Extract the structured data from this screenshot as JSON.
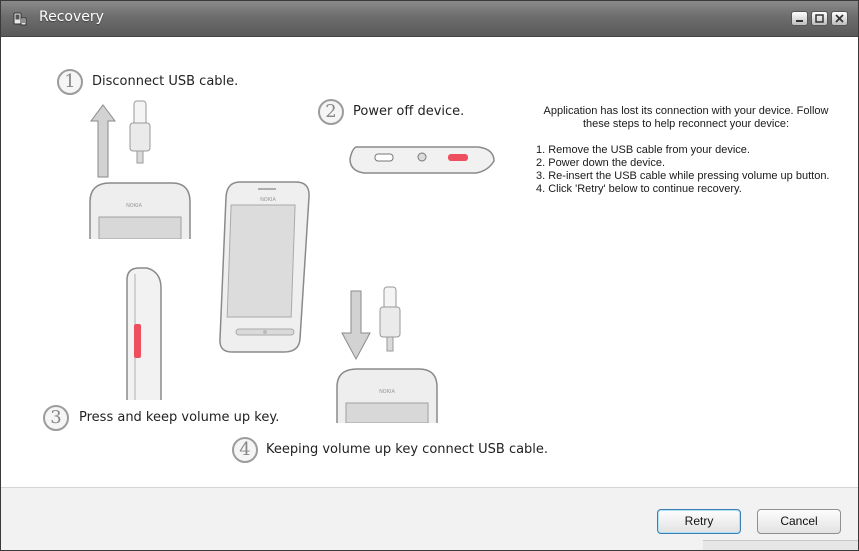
{
  "window": {
    "title": "Recovery",
    "accent": "#3c7fb1"
  },
  "steps": [
    {
      "number": "1",
      "label": "Disconnect USB cable."
    },
    {
      "number": "2",
      "label": "Power off device."
    },
    {
      "number": "3",
      "label": "Press and keep volume up key."
    },
    {
      "number": "4",
      "label": "Keeping volume up key connect USB cable."
    }
  ],
  "device_brand": "NOKIA",
  "instructions": {
    "intro": "Application has lost its connection with your device. Follow these steps to help reconnect your device:",
    "items": [
      "1. Remove the USB cable from your device.",
      "2. Power down the device.",
      "3. Re-insert the USB cable while pressing volume up button.",
      "4. Click 'Retry' below to continue recovery."
    ]
  },
  "buttons": {
    "retry": "Retry",
    "cancel": "Cancel"
  },
  "icons": {
    "app": "device-app-icon",
    "minimize": "minimize-icon",
    "maximize": "maximize-icon",
    "close": "close-icon"
  }
}
